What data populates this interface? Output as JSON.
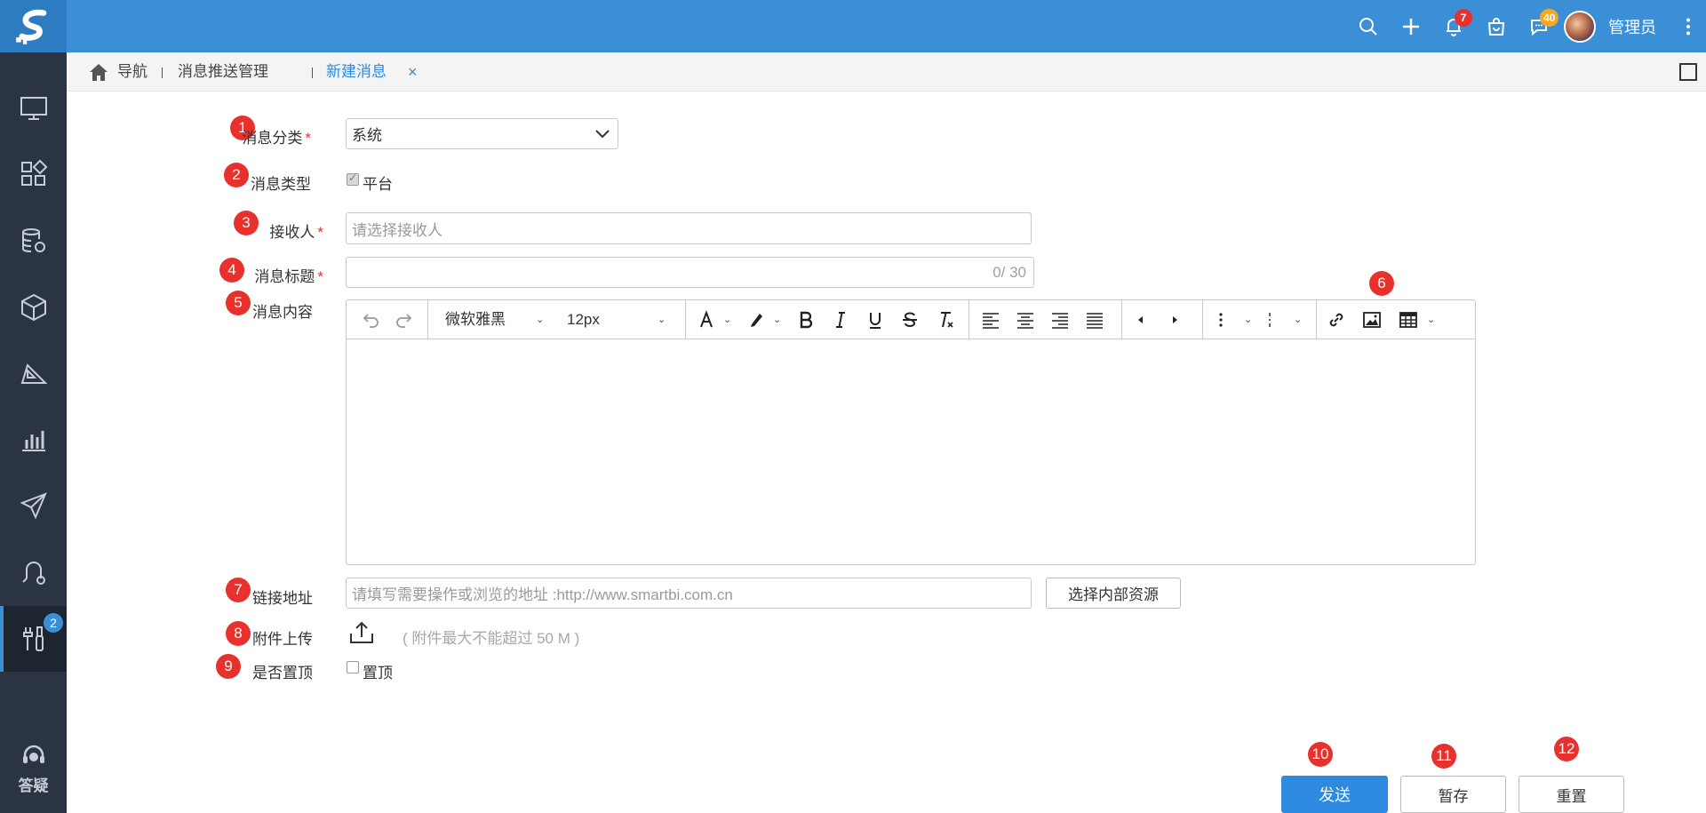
{
  "app": {
    "user_name": "管理员",
    "notification_count": "7",
    "message_count": "40"
  },
  "sidebar": {
    "active_badge": "2",
    "help_label": "答疑",
    "items": [
      "monitor-icon",
      "apps-icon",
      "database-gear-icon",
      "cube-icon",
      "ruler-icon",
      "bar-chart-icon",
      "send-icon",
      "agent-icon",
      "tools-icon"
    ]
  },
  "breadcrumb": {
    "home": "导航",
    "parent": "消息推送管理",
    "current": "新建消息",
    "close": "×"
  },
  "form": {
    "category": {
      "label": "消息分类",
      "required": "*",
      "value": "系统"
    },
    "type": {
      "label": "消息类型",
      "option": "平台",
      "checked": true
    },
    "receiver": {
      "label": "接收人",
      "required": "*",
      "placeholder": "请选择接收人"
    },
    "title": {
      "label": "消息标题",
      "required": "*",
      "value": "",
      "counter": "0/ 30"
    },
    "content": {
      "label": "消息内容"
    },
    "link": {
      "label": "链接地址",
      "placeholder": "请填写需要操作或浏览的地址 :http://www.smartbi.com.cn",
      "button": "选择内部资源"
    },
    "attachment": {
      "label": "附件上传",
      "hint": "( 附件最大不能超过 50 M )"
    },
    "pin": {
      "label": "是否置顶",
      "option": "置顶",
      "checked": false
    }
  },
  "editor": {
    "font_family": "微软雅黑",
    "font_size": "12px"
  },
  "actions": {
    "send": "发送",
    "save_draft": "暂存",
    "reset": "重置"
  },
  "markers": [
    "1",
    "2",
    "3",
    "4",
    "5",
    "6",
    "7",
    "8",
    "9",
    "10",
    "11",
    "12"
  ],
  "colors": {
    "topbar": "#3a8fd6",
    "sidebar": "#2b3442",
    "primary": "#2d8ae0",
    "marker": "#e8302c"
  }
}
